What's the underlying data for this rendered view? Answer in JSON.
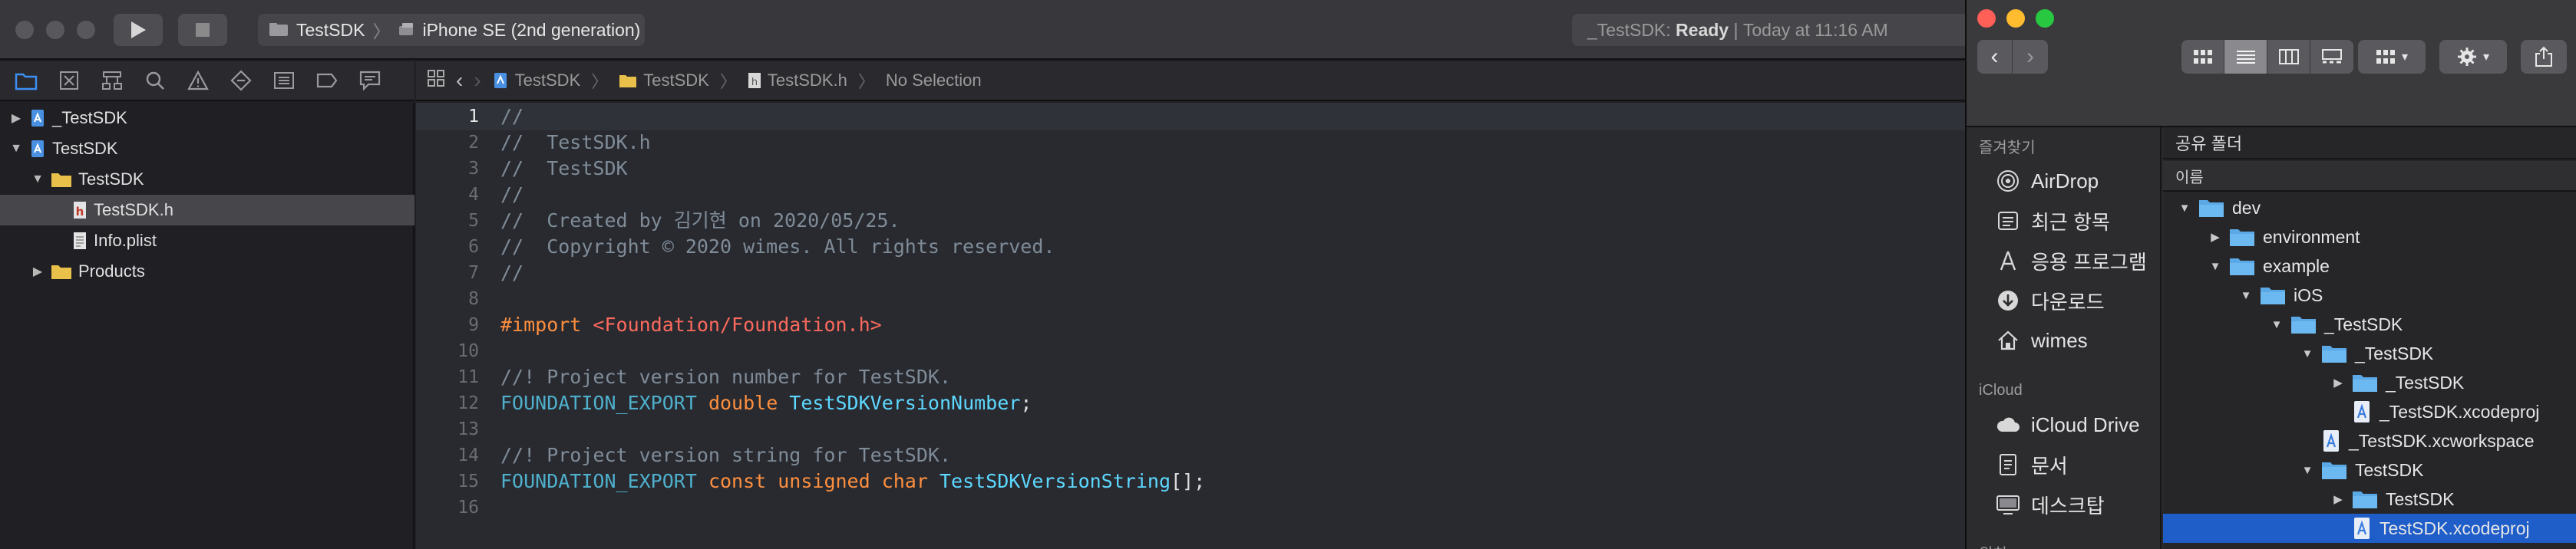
{
  "xcode": {
    "scheme": {
      "project": "TestSDK",
      "device": "iPhone SE (2nd generation)"
    },
    "status": {
      "project": "_TestSDK:",
      "state": "Ready",
      "separator": "|",
      "time": "Today at 11:16 AM"
    },
    "navigator": {
      "items": [
        {
          "label": "_TestSDK",
          "depth": 0,
          "expanded": false,
          "icon": "project-icon"
        },
        {
          "label": "TestSDK",
          "depth": 0,
          "expanded": true,
          "icon": "project-icon"
        },
        {
          "label": "TestSDK",
          "depth": 1,
          "expanded": true,
          "icon": "folder-icon"
        },
        {
          "label": "TestSDK.h",
          "depth": 2,
          "selected": true,
          "icon": "header-file-icon"
        },
        {
          "label": "Info.plist",
          "depth": 2,
          "icon": "plist-file-icon"
        },
        {
          "label": "Products",
          "depth": 1,
          "expanded": false,
          "icon": "folder-icon"
        }
      ]
    },
    "jumpbar": {
      "crumbs": [
        "TestSDK",
        "TestSDK",
        "TestSDK.h",
        "No Selection"
      ]
    },
    "editor": {
      "current_line": 1,
      "lines": [
        {
          "n": "1",
          "segs": [
            {
              "t": "//",
              "c": "c-comment"
            }
          ]
        },
        {
          "n": "2",
          "segs": [
            {
              "t": "//  TestSDK.h",
              "c": "c-comment"
            }
          ]
        },
        {
          "n": "3",
          "segs": [
            {
              "t": "//  TestSDK",
              "c": "c-comment"
            }
          ]
        },
        {
          "n": "4",
          "segs": [
            {
              "t": "//",
              "c": "c-comment"
            }
          ]
        },
        {
          "n": "5",
          "segs": [
            {
              "t": "//  Created by 김기현 on 2020/05/25.",
              "c": "c-comment"
            }
          ]
        },
        {
          "n": "6",
          "segs": [
            {
              "t": "//  Copyright © 2020 wimes. All rights reserved.",
              "c": "c-comment"
            }
          ]
        },
        {
          "n": "7",
          "segs": [
            {
              "t": "//",
              "c": "c-comment"
            }
          ]
        },
        {
          "n": "8",
          "segs": []
        },
        {
          "n": "9",
          "segs": [
            {
              "t": "#import ",
              "c": "c-pre"
            },
            {
              "t": "<Foundation/Foundation.h>",
              "c": "c-str"
            }
          ]
        },
        {
          "n": "10",
          "segs": []
        },
        {
          "n": "11",
          "segs": [
            {
              "t": "//! Project version number for TestSDK.",
              "c": "c-comment"
            }
          ]
        },
        {
          "n": "12",
          "segs": [
            {
              "t": "FOUNDATION_EXPORT ",
              "c": "c-type2"
            },
            {
              "t": "double ",
              "c": "c-pre"
            },
            {
              "t": "TestSDKVersionNumber",
              "c": "c-ident"
            },
            {
              "t": ";",
              "c": "c-plain"
            }
          ]
        },
        {
          "n": "13",
          "segs": []
        },
        {
          "n": "14",
          "segs": [
            {
              "t": "//! Project version string for TestSDK.",
              "c": "c-comment"
            }
          ]
        },
        {
          "n": "15",
          "segs": [
            {
              "t": "FOUNDATION_EXPORT ",
              "c": "c-type2"
            },
            {
              "t": "const unsigned char ",
              "c": "c-pre"
            },
            {
              "t": "TestSDKVersionString",
              "c": "c-ident"
            },
            {
              "t": "[];",
              "c": "c-plain"
            }
          ]
        },
        {
          "n": "16",
          "segs": []
        }
      ]
    }
  },
  "finder": {
    "sidebar": {
      "favorites_title": "즐겨찾기",
      "favorites": [
        {
          "label": "AirDrop",
          "icon": "airdrop-icon"
        },
        {
          "label": "최근 항목",
          "icon": "recents-icon"
        },
        {
          "label": "응용 프로그램",
          "icon": "applications-icon"
        },
        {
          "label": "다운로드",
          "icon": "downloads-icon"
        },
        {
          "label": "wimes",
          "icon": "home-icon"
        }
      ],
      "icloud_title": "iCloud",
      "icloud": [
        {
          "label": "iCloud Drive",
          "icon": "icloud-icon"
        },
        {
          "label": "문서",
          "icon": "documents-icon"
        },
        {
          "label": "데스크탑",
          "icon": "desktop-icon"
        }
      ],
      "more_title": "위치"
    },
    "path_title": "공유 폴더",
    "column_name": "이름",
    "rows": [
      {
        "label": "dev",
        "depth": 0,
        "disclosure": "open",
        "icon": "folder"
      },
      {
        "label": "environment",
        "depth": 1,
        "disclosure": "closed",
        "icon": "folder"
      },
      {
        "label": "example",
        "depth": 1,
        "disclosure": "open",
        "icon": "folder"
      },
      {
        "label": "iOS",
        "depth": 2,
        "disclosure": "open",
        "icon": "folder"
      },
      {
        "label": "_TestSDK",
        "depth": 3,
        "disclosure": "open",
        "icon": "folder"
      },
      {
        "label": "_TestSDK",
        "depth": 4,
        "disclosure": "open",
        "icon": "folder"
      },
      {
        "label": "_TestSDK",
        "depth": 5,
        "disclosure": "closed",
        "icon": "folder"
      },
      {
        "label": "_TestSDK.xcodeproj",
        "depth": 5,
        "disclosure": "none",
        "icon": "xcodeproj"
      },
      {
        "label": "_TestSDK.xcworkspace",
        "depth": 4,
        "disclosure": "none",
        "icon": "xcworkspace"
      },
      {
        "label": "TestSDK",
        "depth": 4,
        "disclosure": "open",
        "icon": "folder"
      },
      {
        "label": "TestSDK",
        "depth": 5,
        "disclosure": "closed",
        "icon": "folder"
      },
      {
        "label": "TestSDK.xcodeproj",
        "depth": 5,
        "disclosure": "none",
        "icon": "xcodeproj",
        "selected": true
      }
    ]
  },
  "colors": {
    "finder_selection": "#1f5dc9",
    "folder_blue": "#5aa9e6",
    "folder_yellow": "#e9c04a",
    "traffic_red": "#fe5f57",
    "traffic_yellow": "#febc2e",
    "traffic_green": "#28c840"
  }
}
